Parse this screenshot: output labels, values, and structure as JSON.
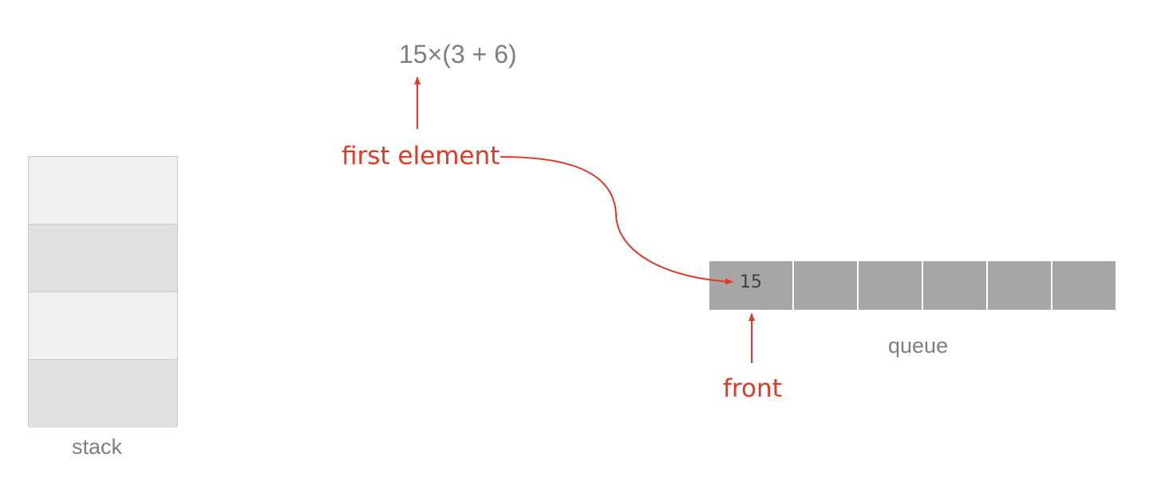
{
  "expression": "15×(3 + 6)",
  "annotations": {
    "first_element": "first element",
    "front": "front"
  },
  "stack": {
    "label": "stack",
    "cells": [
      "",
      "",
      "",
      ""
    ]
  },
  "queue": {
    "label": "queue",
    "cells": [
      "15",
      "",
      "",
      "",
      "",
      ""
    ]
  },
  "colors": {
    "accent": "#e03a26",
    "text_gray": "#7f7f7f",
    "queue_fill": "#a6a6a6",
    "stack_light": "#f0f0f0",
    "stack_dark": "#e0e0e0"
  }
}
